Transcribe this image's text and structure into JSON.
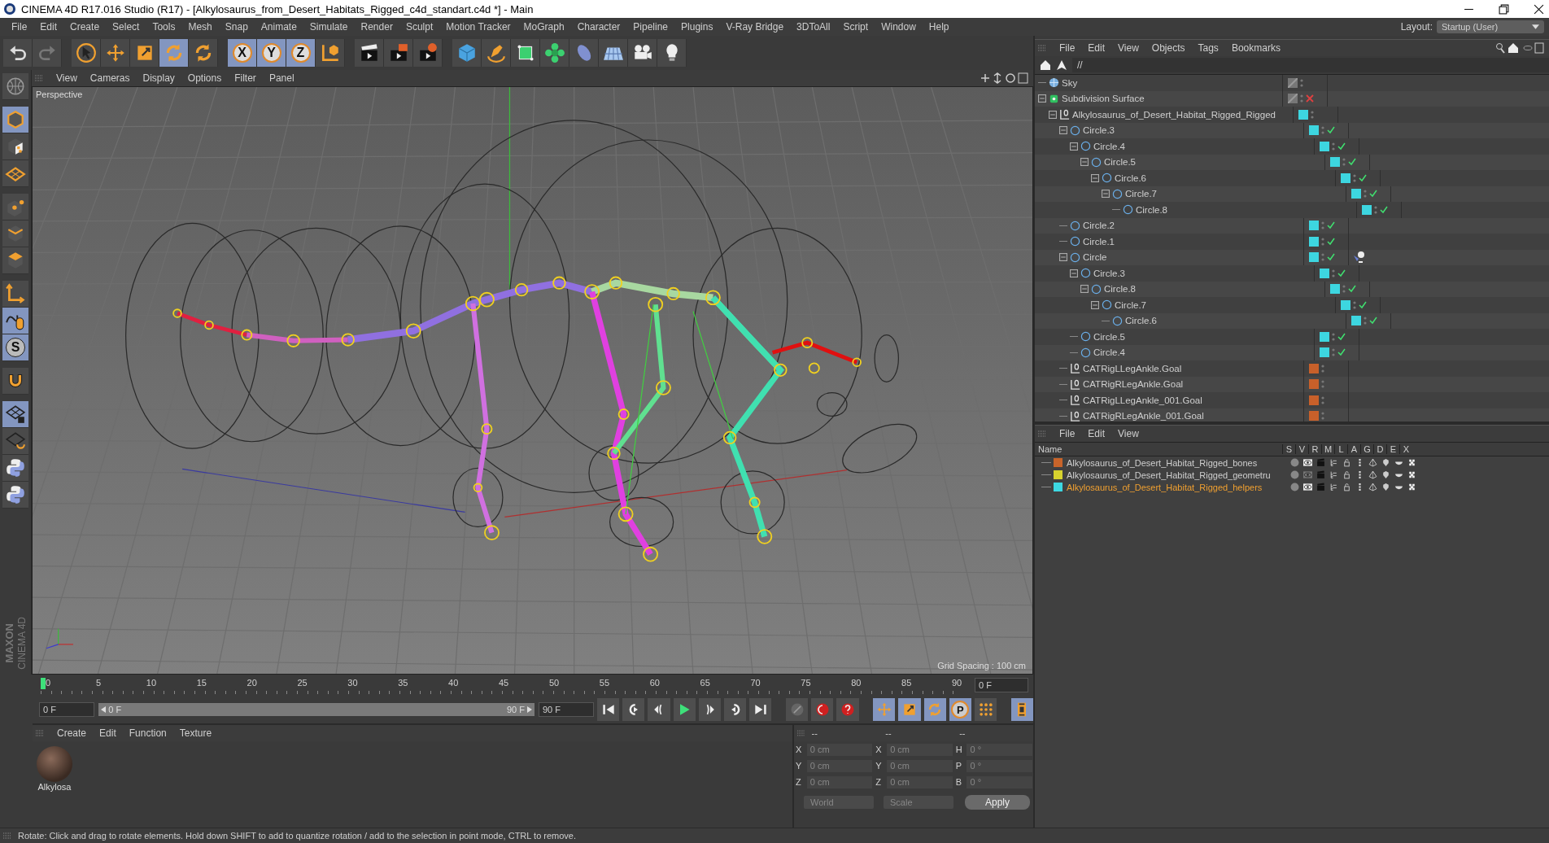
{
  "window": {
    "title": "CINEMA 4D R17.016 Studio (R17) - [Alkylosaurus_from_Desert_Habitats_Rigged_c4d_standart.c4d *] - Main"
  },
  "menu_bar": [
    "File",
    "Edit",
    "Create",
    "Select",
    "Tools",
    "Mesh",
    "Snap",
    "Animate",
    "Simulate",
    "Render",
    "Sculpt",
    "Motion Tracker",
    "MoGraph",
    "Character",
    "Pipeline",
    "Plugins",
    "V-Ray Bridge",
    "3DToAll",
    "Script",
    "Window",
    "Help"
  ],
  "layout": {
    "label": "Layout:",
    "value": "Startup (User)"
  },
  "main_toolbar": [
    {
      "selected": false
    },
    {
      "selected": false
    },
    {
      "selected": false
    },
    {
      "selected": false
    },
    {
      "selected": false
    },
    {
      "selected": true
    },
    {
      "selected": false
    },
    {
      "label": "X",
      "selected": true
    },
    {
      "label": "Y",
      "selected": true
    },
    {
      "label": "Z",
      "selected": true
    },
    {
      "selected": false
    },
    {
      "selected": false
    },
    {
      "selected": false
    },
    {
      "selected": false
    },
    {
      "selected": false
    },
    {
      "selected": false
    },
    {
      "selected": false
    },
    {
      "selected": false
    },
    {
      "selected": false
    },
    {
      "selected": false
    },
    {
      "selected": false
    },
    {
      "selected": false
    }
  ],
  "left_toolbar": [
    {
      "selected": false
    },
    {
      "selected": true
    },
    {
      "selected": false
    },
    {
      "selected": false
    },
    {
      "selected": false
    },
    {
      "selected": false
    },
    {
      "selected": false
    },
    {
      "selected": false
    },
    {
      "selected": true
    },
    {
      "label": "S",
      "selected": true
    },
    {
      "selected": false
    },
    {
      "selected": true
    },
    {
      "selected": false
    },
    {
      "selected": false
    },
    {
      "selected": false
    }
  ],
  "viewport": {
    "menu": [
      "View",
      "Cameras",
      "Display",
      "Options",
      "Filter",
      "Panel"
    ],
    "camera": "Perspective",
    "grid_spacing": "Grid Spacing : 100 cm"
  },
  "timeline": {
    "ticks": [
      "0",
      "5",
      "10",
      "15",
      "20",
      "25",
      "30",
      "35",
      "40",
      "45",
      "50",
      "55",
      "60",
      "65",
      "70",
      "75",
      "80",
      "85",
      "90"
    ],
    "level": 0,
    "current": "0 F",
    "start": "0 F",
    "range": {
      "start": "0 F",
      "end": "90 F"
    },
    "end": "90 F"
  },
  "transport": [
    {
      "selected": false
    },
    {
      "selected": false
    },
    {
      "selected": false
    },
    {
      "selected": false
    },
    {
      "selected": false
    },
    {
      "selected": false
    },
    {
      "selected": false
    },
    {
      "selected": false
    },
    {
      "selected": false
    },
    {
      "selected": false
    },
    {
      "selected": true
    },
    {
      "selected": true
    },
    {
      "selected": true
    },
    {
      "label": "P",
      "selected": true
    },
    {
      "selected": false
    },
    {
      "selected": true
    }
  ],
  "materials": {
    "menu": [
      "Create",
      "Edit",
      "Function",
      "Texture"
    ],
    "items": [
      {
        "name": "Alkylosa"
      }
    ]
  },
  "coordinates": {
    "headers": [
      "--",
      "--",
      "--"
    ],
    "rows": [
      {
        "axis": "X",
        "position": "0 cm",
        "size_axis": "X",
        "size": "0 cm",
        "rot_axis": "H",
        "rotation": "0 °"
      },
      {
        "axis": "Y",
        "position": "0 cm",
        "size_axis": "Y",
        "size": "0 cm",
        "rot_axis": "P",
        "rotation": "0 °"
      },
      {
        "axis": "Z",
        "position": "0 cm",
        "size_axis": "Z",
        "size": "0 cm",
        "rot_axis": "B",
        "rotation": "0 °"
      }
    ],
    "mode": "World",
    "type": "Scale",
    "apply": "Apply"
  },
  "object_manager": {
    "menu": [
      "File",
      "Edit",
      "View",
      "Objects",
      "Tags",
      "Bookmarks"
    ],
    "path": "//",
    "objects": [
      {
        "name": "Sky",
        "kind": "sky"
      },
      {
        "name": "Subdivision Surface",
        "kind": "subdivision",
        "enabled": false,
        "expanded": true,
        "children": [
          {
            "name": "Alkylosaurus_of_Desert_Habitat_Rigged_Rigged",
            "kind": "null",
            "color": "#3dd6e0",
            "expanded": true,
            "children": [
              {
                "name": "Circle.3",
                "kind": "circle",
                "color": "#3dd6e0",
                "enabled": true,
                "expanded": true,
                "children": [
                  {
                    "name": "Circle.4",
                    "kind": "circle",
                    "color": "#3dd6e0",
                    "enabled": true,
                    "expanded": true,
                    "children": [
                      {
                        "name": "Circle.5",
                        "kind": "circle",
                        "color": "#3dd6e0",
                        "enabled": true,
                        "expanded": true,
                        "children": [
                          {
                            "name": "Circle.6",
                            "kind": "circle",
                            "color": "#3dd6e0",
                            "enabled": true,
                            "expanded": true,
                            "children": [
                              {
                                "name": "Circle.7",
                                "kind": "circle",
                                "color": "#3dd6e0",
                                "enabled": true,
                                "expanded": true,
                                "children": [
                                  {
                                    "name": "Circle.8",
                                    "kind": "circle",
                                    "color": "#3dd6e0",
                                    "enabled": true
                                  }
                                ]
                              }
                            ]
                          }
                        ]
                      }
                    ]
                  }
                ]
              },
              {
                "name": "Circle.2",
                "kind": "circle",
                "color": "#3dd6e0",
                "enabled": true
              },
              {
                "name": "Circle.1",
                "kind": "circle",
                "color": "#3dd6e0",
                "enabled": true
              },
              {
                "name": "Circle",
                "kind": "circle",
                "color": "#3dd6e0",
                "enabled": true,
                "tags": [
                  {
                    "kind": "ik"
                  }
                ],
                "expanded": true,
                "children": [
                  {
                    "name": "Circle.3",
                    "kind": "circle",
                    "color": "#3dd6e0",
                    "enabled": true,
                    "expanded": true,
                    "children": [
                      {
                        "name": "Circle.8",
                        "kind": "circle",
                        "color": "#3dd6e0",
                        "enabled": true,
                        "expanded": true,
                        "children": [
                          {
                            "name": "Circle.7",
                            "kind": "circle",
                            "color": "#3dd6e0",
                            "enabled": true,
                            "expanded": true,
                            "children": [
                              {
                                "name": "Circle.6",
                                "kind": "circle",
                                "color": "#3dd6e0",
                                "enabled": true
                              }
                            ]
                          }
                        ]
                      }
                    ]
                  },
                  {
                    "name": "Circle.5",
                    "kind": "circle",
                    "color": "#3dd6e0",
                    "enabled": true
                  },
                  {
                    "name": "Circle.4",
                    "kind": "circle",
                    "color": "#3dd6e0",
                    "enabled": true
                  }
                ]
              },
              {
                "name": "CATRigLLegAnkle.Goal",
                "kind": "null",
                "color": "#c8602a"
              },
              {
                "name": "CATRigRLegAnkle.Goal",
                "kind": "null",
                "color": "#c8602a"
              },
              {
                "name": "CATRigLLegAnkle_001.Goal",
                "kind": "null",
                "color": "#c8602a"
              },
              {
                "name": "CATRigRLegAnkle_001.Goal",
                "kind": "null",
                "color": "#c8602a"
              }
            ]
          }
        ]
      }
    ]
  },
  "layer_manager": {
    "menu": [
      "File",
      "Edit",
      "View"
    ],
    "columns": [
      "Name",
      "S",
      "V",
      "R",
      "M",
      "L",
      "A",
      "G",
      "D",
      "E",
      "X"
    ],
    "layers": [
      {
        "name": "Alkylosaurus_of_Desert_Habitat_Rigged_bones",
        "color": "#c8642a",
        "visible": true,
        "selected": false
      },
      {
        "name": "Alkylosaurus_of_Desert_Habitat_Rigged_geometru",
        "color": "#d6d22e",
        "visible": false,
        "selected": false
      },
      {
        "name": "Alkylosaurus_of_Desert_Habitat_Rigged_helpers",
        "color": "#3dd8e2",
        "visible": true,
        "selected": true
      }
    ]
  },
  "branding": {
    "company": "MAXON",
    "product": "CINEMA 4D"
  },
  "status_bar": {
    "text": "Rotate: Click and drag to rotate elements. Hold down SHIFT to add to quantize rotation / add to the selection in point mode, CTRL to remove."
  }
}
